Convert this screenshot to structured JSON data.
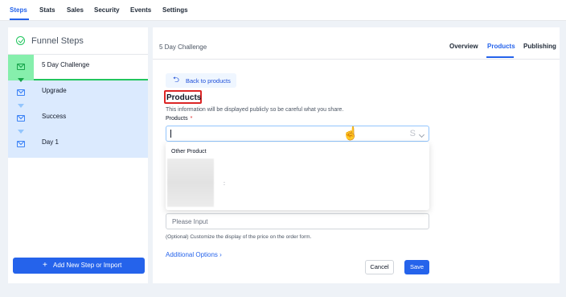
{
  "top_nav": {
    "tabs": [
      {
        "label": "Steps",
        "active": true
      },
      {
        "label": "Stats",
        "active": false
      },
      {
        "label": "Sales",
        "active": false
      },
      {
        "label": "Security",
        "active": false
      },
      {
        "label": "Events",
        "active": false
      },
      {
        "label": "Settings",
        "active": false
      }
    ]
  },
  "sidebar": {
    "title": "Funnel Steps",
    "steps": [
      {
        "label": "5 Day Challenge",
        "icon": "mail-icon",
        "active": true
      },
      {
        "label": "Upgrade",
        "icon": "mail-icon",
        "active": false
      },
      {
        "label": "Success",
        "icon": "mail-icon",
        "active": false
      },
      {
        "label": "Day 1",
        "icon": "mail-icon",
        "active": false
      }
    ],
    "add_button": {
      "icon": "+",
      "label": "Add New Step or Import"
    }
  },
  "panel": {
    "title": "5 Day Challenge",
    "tabs": [
      {
        "label": "Overview",
        "active": false
      },
      {
        "label": "Products",
        "active": true
      },
      {
        "label": "Publishing",
        "active": false
      }
    ],
    "back_button": {
      "icon": "⮌",
      "label": "Back to products"
    },
    "section_title": "Products",
    "info_text": "This information will be displayed publicly so be careful what you share.",
    "field_label": "Products",
    "required_mark": "*",
    "select": {
      "value": "",
      "sync_icon": "S"
    },
    "dropdown": {
      "option": "Other Product",
      "colon": ":"
    },
    "price_input": {
      "placeholder": "Please Input",
      "value": ""
    },
    "hint": "(Optional) Customize the display of the price on the order form.",
    "additional_options": "Additional Options  ›",
    "cancel_label": "Cancel",
    "save_label": "Save"
  },
  "colors": {
    "accent": "#2563eb",
    "success": "#22c55e",
    "highlight_box": "#dc2626",
    "sidebar_bg": "#dbeafe"
  }
}
